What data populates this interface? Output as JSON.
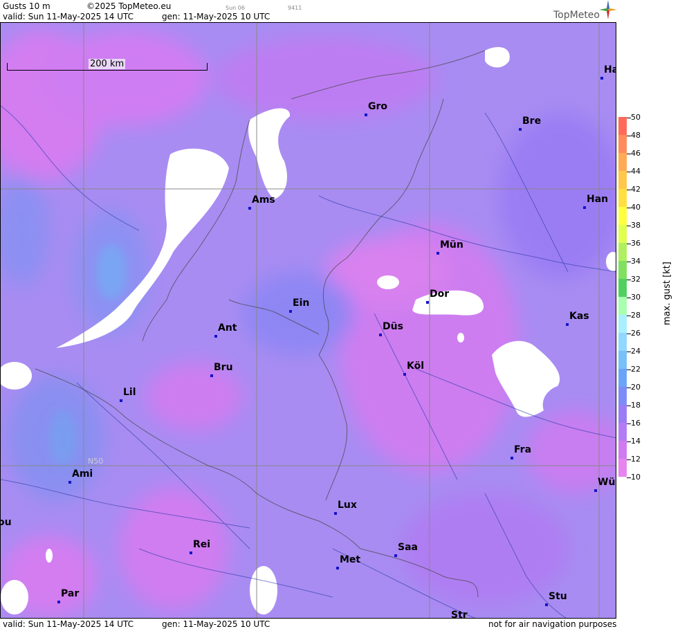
{
  "header": {
    "product": "Gusts 10 m",
    "copyright": "©2025 TopMeteo.eu",
    "run_small": "Sun 06",
    "code_small": "9411",
    "valid": "valid:  Sun  11-May-2025  14 UTC",
    "gen": "gen: 11-May-2025 10 UTC",
    "logo": "TopMeteo"
  },
  "map": {
    "scale_label": "200 km",
    "lat_label": "N50",
    "cities": [
      {
        "label": "Ha"
      },
      {
        "label": "Gro"
      },
      {
        "label": "Bre"
      },
      {
        "label": "Ams"
      },
      {
        "label": "Han"
      },
      {
        "label": "Mün"
      },
      {
        "label": "Dor"
      },
      {
        "label": "Ein"
      },
      {
        "label": "Kas"
      },
      {
        "label": "Ant"
      },
      {
        "label": "Düs"
      },
      {
        "label": "Köl"
      },
      {
        "label": "Bru"
      },
      {
        "label": "Lil"
      },
      {
        "label": "Fra"
      },
      {
        "label": "Ami"
      },
      {
        "label": "Wü"
      },
      {
        "label": "Lux"
      },
      {
        "label": "ou"
      },
      {
        "label": "Rei"
      },
      {
        "label": "Saa"
      },
      {
        "label": "Met"
      },
      {
        "label": "Par"
      },
      {
        "label": "Stu"
      },
      {
        "label": "Str"
      }
    ]
  },
  "legend": {
    "title": "max. gust [kt]",
    "ticks": [
      "50",
      "48",
      "46",
      "44",
      "42",
      "40",
      "38",
      "36",
      "34",
      "32",
      "30",
      "28",
      "26",
      "24",
      "22",
      "20",
      "18",
      "16",
      "14",
      "12",
      "10"
    ],
    "colors": [
      "#ff6a5a",
      "#ff8c5a",
      "#ffaa55",
      "#ffc84a",
      "#ffe040",
      "#ffff40",
      "#e0ff50",
      "#b0f060",
      "#80e060",
      "#50d060",
      "#a8ffb0",
      "#a8f0ff",
      "#90d8ff",
      "#78c0f8",
      "#6aa4f8",
      "#7c8cf8",
      "#9a7cf6",
      "#b47cf4",
      "#d07cf0",
      "#e884f0"
    ]
  },
  "footer": {
    "valid": "valid:  Sun  11-May-2025  14 UTC",
    "gen": "gen: 11-May-2025 10 UTC",
    "note": "not for air navigation purposes"
  }
}
